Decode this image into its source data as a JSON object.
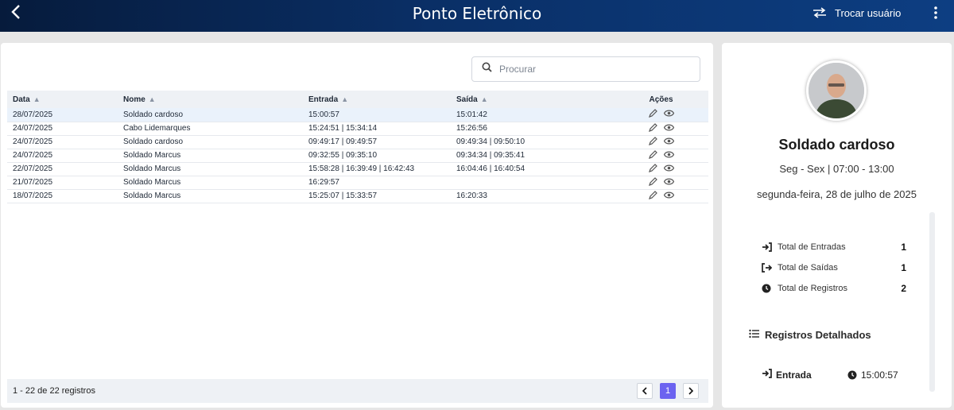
{
  "header": {
    "title": "Ponto Eletrônico",
    "switch_user_label": "Trocar usuário",
    "icons": {
      "back": "chevron-left-icon",
      "switch": "swap-arrows-icon",
      "menu": "kebab-menu-icon"
    }
  },
  "search": {
    "placeholder": "Procurar",
    "value": ""
  },
  "table": {
    "columns": [
      "Data",
      "Nome",
      "Entrada",
      "Saída",
      "Ações"
    ],
    "rows": [
      {
        "data": "28/07/2025",
        "nome": "Soldado cardoso",
        "entrada": "15:00:57",
        "saida": "15:01:42"
      },
      {
        "data": "24/07/2025",
        "nome": "Cabo Lidemarques",
        "entrada": "15:24:51 | 15:34:14",
        "saida": "15:26:56"
      },
      {
        "data": "24/07/2025",
        "nome": "Soldado cardoso",
        "entrada": "09:49:17 | 09:49:57",
        "saida": "09:49:34 | 09:50:10"
      },
      {
        "data": "24/07/2025",
        "nome": "Soldado Marcus",
        "entrada": "09:32:55 | 09:35:10",
        "saida": "09:34:34 | 09:35:41"
      },
      {
        "data": "22/07/2025",
        "nome": "Soldado Marcus",
        "entrada": "15:58:28 | 16:39:49 | 16:42:43",
        "saida": "16:04:46 | 16:40:54"
      },
      {
        "data": "21/07/2025",
        "nome": "Soldado Marcus",
        "entrada": "16:29:57",
        "saida": ""
      },
      {
        "data": "18/07/2025",
        "nome": "Soldado Marcus",
        "entrada": "15:25:07 | 15:33:57",
        "saida": "16:20:33"
      }
    ],
    "selected_row": 0
  },
  "pagination": {
    "summary": "1 - 22 de 22 registros",
    "current_page": "1"
  },
  "profile": {
    "name": "Soldado cardoso",
    "schedule": "Seg - Sex | 07:00 - 13:00",
    "date": "segunda-feira, 28 de julho de 2025",
    "stats": [
      {
        "label": "Total de Entradas",
        "value": "1",
        "icon": "sign-in-icon"
      },
      {
        "label": "Total de Saídas",
        "value": "1",
        "icon": "sign-out-icon"
      },
      {
        "label": "Total de Registros",
        "value": "2",
        "icon": "clock-icon"
      }
    ],
    "detail_title": "Registros Detalhados",
    "detail_entry": {
      "label": "Entrada",
      "time": "15:00:57"
    }
  },
  "colors": {
    "header_dark": "#061b3c",
    "header_light": "#0d3e82",
    "accent": "#6c63f0",
    "row_selected": "#eaf2fb"
  }
}
